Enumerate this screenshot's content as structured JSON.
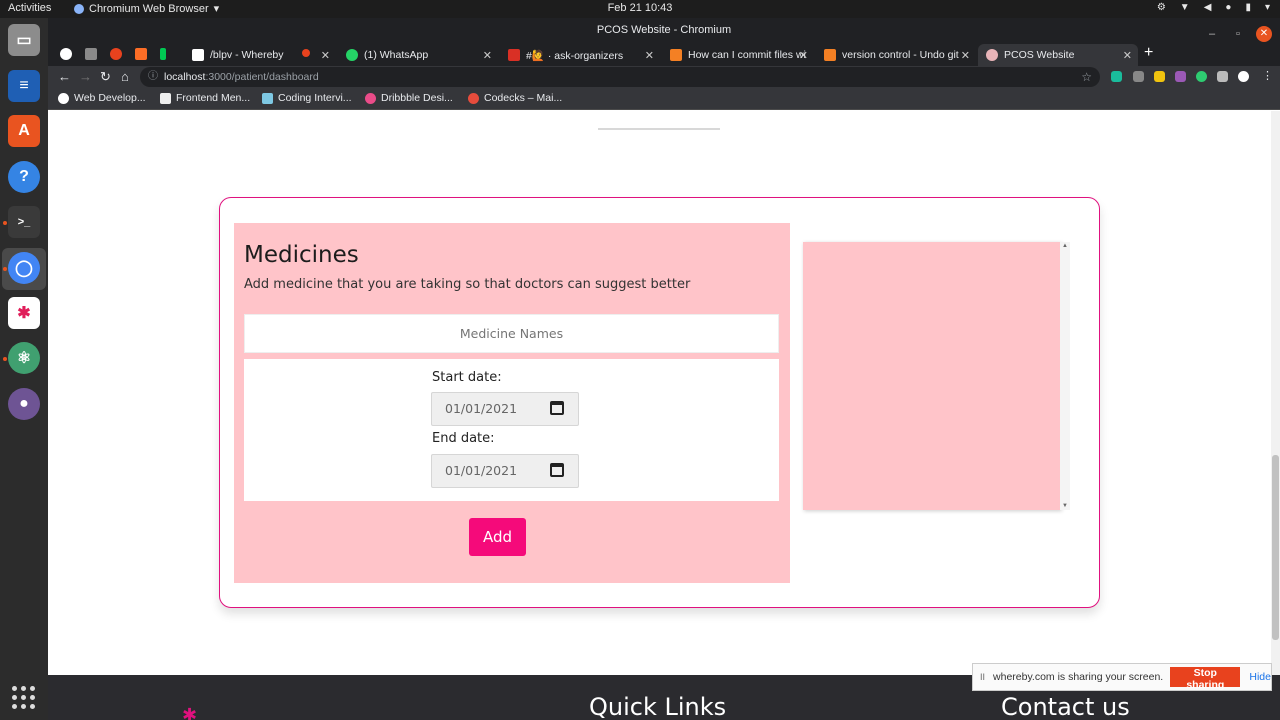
{
  "system": {
    "activities": "Activities",
    "app_name": "Chromium Web Browser",
    "clock": "Feb 21  10:43"
  },
  "window": {
    "title": "PCOS Website - Chromium"
  },
  "tabs": [
    {
      "label": "/blpv - Whereby"
    },
    {
      "label": "(1) WhatsApp"
    },
    {
      "label": "#🙋 · ask-organizers"
    },
    {
      "label": "How can I commit files wi"
    },
    {
      "label": "version control - Undo git"
    },
    {
      "label": "PCOS Website"
    }
  ],
  "address": {
    "host": "localhost",
    "path": ":3000/patient/dashboard"
  },
  "bookmarks": [
    {
      "label": "Web Develop..."
    },
    {
      "label": "Frontend Men..."
    },
    {
      "label": "Coding Intervi..."
    },
    {
      "label": "Dribbble Desi..."
    },
    {
      "label": "Codecks – Mai..."
    }
  ],
  "medicines": {
    "title": "Medicines",
    "subtitle": "Add medicine that you are taking so that doctors can suggest better",
    "name_placeholder": "Medicine Names",
    "start_label": "Start date:",
    "start_value": "01/01/2021",
    "end_label": "End date:",
    "end_value": "01/01/2021",
    "add_label": "Add"
  },
  "footer": {
    "quick_links": "Quick Links",
    "contact": "Contact us"
  },
  "share": {
    "message": "whereby.com is sharing your screen.",
    "stop_label": "Stop sharing",
    "hide_label": "Hide"
  },
  "colors": {
    "accent": "#f50a7a",
    "panel": "#ffc4c9",
    "card_border": "#e0117f"
  }
}
